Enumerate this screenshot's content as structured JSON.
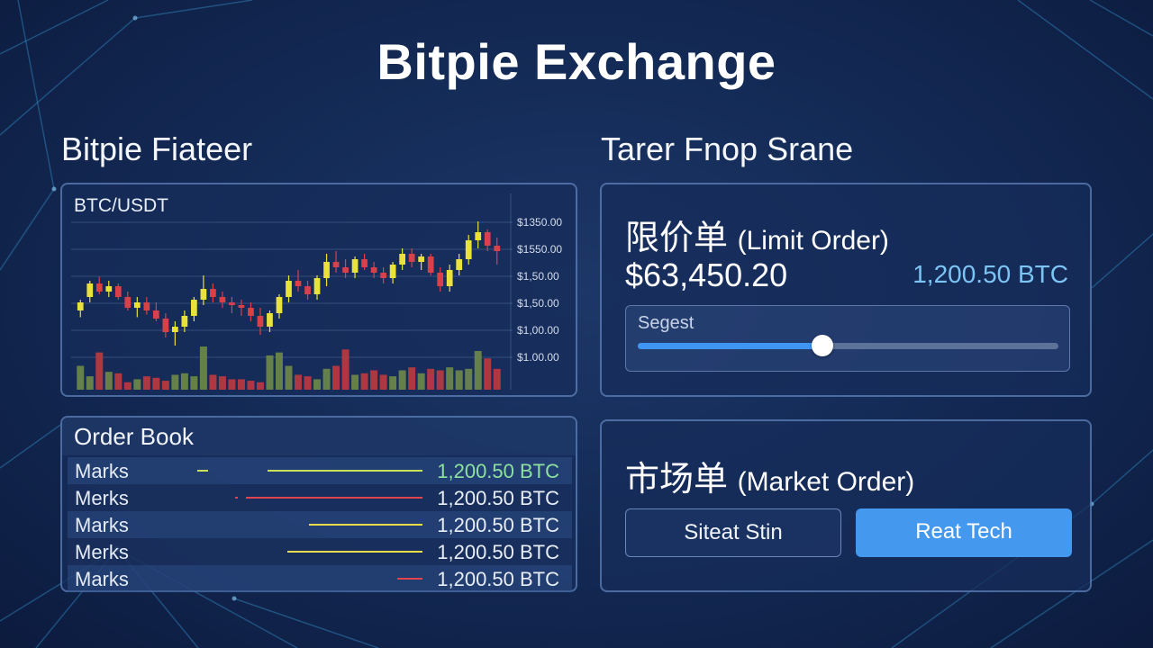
{
  "app_title": "Bitpie Exchange",
  "left_section": {
    "heading": "Bitpie Fiateer",
    "chart_panel": {
      "pair_label": "BTC/USDT"
    },
    "order_book": {
      "title": "Order Book",
      "rows": [
        {
          "name": "Marks",
          "quantity": "1,200.50 BTC",
          "bar_color": "#c8e05a",
          "tone": "green"
        },
        {
          "name": "Merks",
          "quantity": "1,200.50 BTC",
          "bar_color": "#e0444c",
          "tone": "plain"
        },
        {
          "name": "Marks",
          "quantity": "1,200.50 BTC",
          "bar_color": "#e8dc4a",
          "tone": "plain"
        },
        {
          "name": "Merks",
          "quantity": "1,200.50 BTC",
          "bar_color": "#e8dc4a",
          "tone": "plain"
        },
        {
          "name": "Marks",
          "quantity": "1,200.50 BTC",
          "bar_color": "#e0444c",
          "tone": "plain"
        }
      ]
    }
  },
  "right_section": {
    "heading": "Tarer Fnop Srane",
    "limit_order": {
      "title_cjk": "限价单",
      "title_latin": "(Limit Order)",
      "price": "$63,450.20",
      "quantity": "1,200.50 BTC",
      "slider": {
        "label": "Segest",
        "value_fraction": 0.44
      }
    },
    "market_order": {
      "title_cjk": "市场单",
      "title_latin": "(Market Order)",
      "button_secondary": "Siteat Stin",
      "button_primary": "Reat Tech"
    }
  },
  "colors": {
    "background": "#142b57",
    "accent_blue": "#4499ef",
    "up_candle": "#e8e23a",
    "down_candle": "#d8404a",
    "volume_up": "#6e8a48",
    "volume_down": "#c0383f"
  },
  "chart_data": {
    "type": "candlestick",
    "title": "BTC/USDT",
    "y_tick_labels": [
      "$1350.00",
      "$1550.00",
      "$1,50.00",
      "$1,50.00",
      "$1,00.00",
      "$1.00.00"
    ],
    "ylim": [
      0,
      100
    ],
    "grid": true,
    "candles": [
      {
        "open": 30,
        "high": 38,
        "low": 25,
        "close": 36
      },
      {
        "open": 40,
        "high": 52,
        "low": 36,
        "close": 50
      },
      {
        "open": 50,
        "high": 55,
        "low": 42,
        "close": 44
      },
      {
        "open": 44,
        "high": 52,
        "low": 40,
        "close": 48
      },
      {
        "open": 48,
        "high": 50,
        "low": 38,
        "close": 40
      },
      {
        "open": 40,
        "high": 44,
        "low": 30,
        "close": 32
      },
      {
        "open": 32,
        "high": 40,
        "low": 25,
        "close": 36
      },
      {
        "open": 36,
        "high": 40,
        "low": 27,
        "close": 30
      },
      {
        "open": 30,
        "high": 36,
        "low": 22,
        "close": 24
      },
      {
        "open": 24,
        "high": 28,
        "low": 10,
        "close": 14
      },
      {
        "open": 14,
        "high": 22,
        "low": 4,
        "close": 18
      },
      {
        "open": 18,
        "high": 30,
        "low": 14,
        "close": 26
      },
      {
        "open": 26,
        "high": 40,
        "low": 22,
        "close": 38
      },
      {
        "open": 38,
        "high": 56,
        "low": 34,
        "close": 46
      },
      {
        "open": 46,
        "high": 50,
        "low": 36,
        "close": 40
      },
      {
        "open": 40,
        "high": 44,
        "low": 32,
        "close": 36
      },
      {
        "open": 36,
        "high": 40,
        "low": 28,
        "close": 34
      },
      {
        "open": 34,
        "high": 38,
        "low": 26,
        "close": 32
      },
      {
        "open": 32,
        "high": 36,
        "low": 22,
        "close": 26
      },
      {
        "open": 26,
        "high": 32,
        "low": 12,
        "close": 18
      },
      {
        "open": 18,
        "high": 30,
        "low": 14,
        "close": 28
      },
      {
        "open": 28,
        "high": 42,
        "low": 24,
        "close": 40
      },
      {
        "open": 40,
        "high": 56,
        "low": 36,
        "close": 52
      },
      {
        "open": 52,
        "high": 60,
        "low": 44,
        "close": 48
      },
      {
        "open": 48,
        "high": 52,
        "low": 38,
        "close": 42
      },
      {
        "open": 42,
        "high": 56,
        "low": 38,
        "close": 54
      },
      {
        "open": 54,
        "high": 72,
        "low": 48,
        "close": 66
      },
      {
        "open": 66,
        "high": 74,
        "low": 58,
        "close": 62
      },
      {
        "open": 62,
        "high": 68,
        "low": 54,
        "close": 58
      },
      {
        "open": 58,
        "high": 70,
        "low": 54,
        "close": 68
      },
      {
        "open": 68,
        "high": 72,
        "low": 60,
        "close": 62
      },
      {
        "open": 62,
        "high": 66,
        "low": 54,
        "close": 58
      },
      {
        "open": 58,
        "high": 62,
        "low": 50,
        "close": 54
      },
      {
        "open": 54,
        "high": 66,
        "low": 50,
        "close": 64
      },
      {
        "open": 64,
        "high": 76,
        "low": 60,
        "close": 72
      },
      {
        "open": 72,
        "high": 76,
        "low": 62,
        "close": 66
      },
      {
        "open": 66,
        "high": 72,
        "low": 60,
        "close": 70
      },
      {
        "open": 70,
        "high": 72,
        "low": 56,
        "close": 58
      },
      {
        "open": 58,
        "high": 62,
        "low": 44,
        "close": 48
      },
      {
        "open": 48,
        "high": 64,
        "low": 44,
        "close": 60
      },
      {
        "open": 60,
        "high": 72,
        "low": 56,
        "close": 68
      },
      {
        "open": 68,
        "high": 86,
        "low": 64,
        "close": 82
      },
      {
        "open": 82,
        "high": 96,
        "low": 76,
        "close": 88
      },
      {
        "open": 88,
        "high": 90,
        "low": 74,
        "close": 78
      },
      {
        "open": 78,
        "high": 84,
        "low": 64,
        "close": 74
      }
    ],
    "volume": [
      32,
      18,
      50,
      24,
      22,
      10,
      14,
      18,
      16,
      12,
      20,
      22,
      18,
      58,
      20,
      18,
      14,
      14,
      12,
      10,
      46,
      50,
      32,
      20,
      18,
      14,
      28,
      32,
      54,
      20,
      22,
      26,
      20,
      18,
      26,
      30,
      22,
      28,
      26,
      30,
      26,
      28,
      52,
      42,
      28
    ]
  }
}
